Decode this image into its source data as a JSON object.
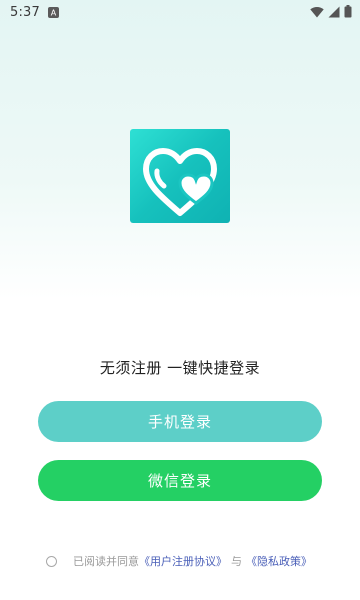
{
  "status_bar": {
    "time": "5:37",
    "app_icon": "A"
  },
  "logo": {
    "icon": "double-heart-icon",
    "colors": {
      "start": "#2ee0d4",
      "end": "#0fb2b3"
    }
  },
  "tagline": "无须注册 一键快捷登录",
  "buttons": {
    "phone_login": "手机登录",
    "wechat_login": "微信登录"
  },
  "agreement": {
    "prefix": "已阅读并同意",
    "user_agreement": "《用户注册协议》",
    "conjunction": "与",
    "privacy_policy": "《隐私政策》"
  },
  "colors": {
    "phone_button": "#5dcfc8",
    "wechat_button": "#24d064",
    "link": "#4a5fb8"
  }
}
